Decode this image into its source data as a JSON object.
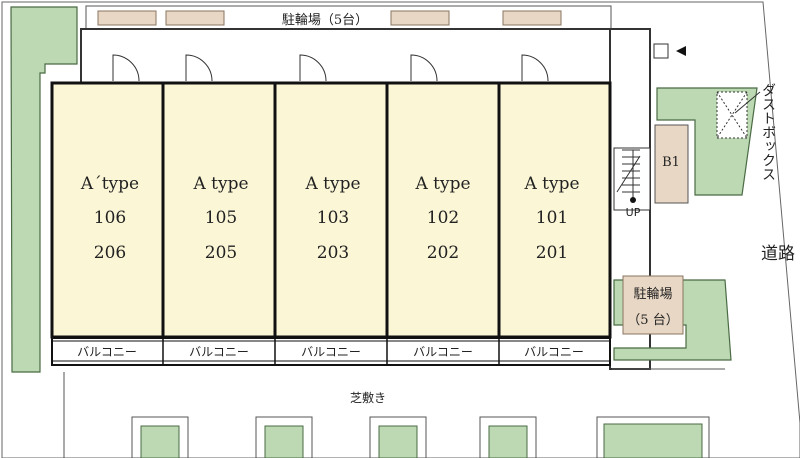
{
  "parking_top": "駐輪場（5台）",
  "units": [
    {
      "type": "A´type",
      "lower": "106",
      "upper": "206",
      "balcony": "バルコニー"
    },
    {
      "type": "A type",
      "lower": "105",
      "upper": "205",
      "balcony": "バルコニー"
    },
    {
      "type": "A type",
      "lower": "103",
      "upper": "203",
      "balcony": "バルコニー"
    },
    {
      "type": "A type",
      "lower": "102",
      "upper": "202",
      "balcony": "バルコニー"
    },
    {
      "type": "A type",
      "lower": "101",
      "upper": "201",
      "balcony": "バルコニー"
    }
  ],
  "b1": "B1",
  "up": "UP",
  "dust_box": "ダストボックス",
  "road": "道路",
  "parking_right": {
    "line1": "駐輪場",
    "line2": "（5 台）"
  },
  "lawn": "芝敷き",
  "colors": {
    "unit_fill": "#fbf6d6",
    "hedge_fill": "#bcd9b4",
    "hedge_stroke": "#4a6b44",
    "parking_fill": "#e8d7c4",
    "wall": "#111111"
  }
}
